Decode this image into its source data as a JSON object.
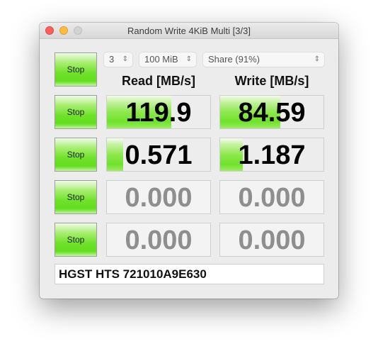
{
  "window": {
    "title": "Random Write 4KiB Multi [3/3]",
    "controls": [
      "close",
      "minimize",
      "zoom"
    ]
  },
  "settings": {
    "count": {
      "value": "3",
      "icon": "up-down-arrows-icon"
    },
    "size": {
      "value": "100 MiB",
      "icon": "up-down-arrows-icon"
    },
    "drive": {
      "value": "Share (91%)",
      "icon": "up-down-arrows-icon"
    }
  },
  "headers": {
    "read": "Read [MB/s]",
    "write": "Write [MB/s]"
  },
  "rows": [
    {
      "button": "Stop",
      "read": "119.9",
      "read_fill": 0.62,
      "write": "84.59",
      "write_fill": 0.58,
      "active": true
    },
    {
      "button": "Stop",
      "read": "0.571",
      "read_fill": 0.16,
      "write": "1.187",
      "write_fill": 0.22,
      "active": true
    },
    {
      "button": "Stop",
      "read": "0.000",
      "read_fill": 0,
      "write": "0.000",
      "write_fill": 0,
      "active": false
    },
    {
      "button": "Stop",
      "read": "0.000",
      "read_fill": 0,
      "write": "0.000",
      "write_fill": 0,
      "active": false
    }
  ],
  "top_button": "Stop",
  "device_name": "HGST HTS 721010A9E630",
  "colors": {
    "accent_green": "#6fe22b",
    "inactive_text": "#8e8e8e"
  },
  "arrows_glyph": "⌃⌄"
}
